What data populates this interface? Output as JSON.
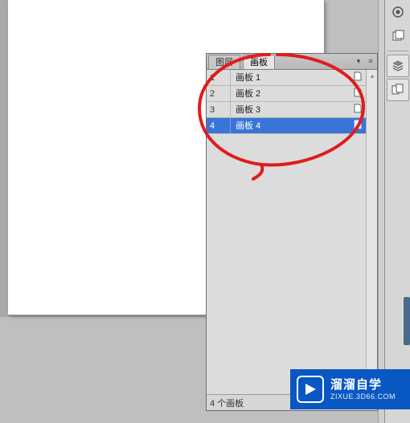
{
  "panel": {
    "tabs": [
      {
        "label": "图层",
        "active": false
      },
      {
        "label": "画板",
        "active": true
      }
    ],
    "artboards": [
      {
        "num": "1",
        "name": "画板 1",
        "selected": false
      },
      {
        "num": "2",
        "name": "画板 2",
        "selected": false
      },
      {
        "num": "3",
        "name": "画板 3",
        "selected": false
      },
      {
        "num": "4",
        "name": "画板 4",
        "selected": true
      }
    ],
    "footer_count": "4 个画板"
  },
  "toolbar": {
    "icons": [
      "circle-target-icon",
      "artboard-tool-icon",
      "layers-icon",
      "artboards-icon"
    ]
  },
  "watermark": {
    "cn": "溜溜自学",
    "en": "ZIXUE.3D66.COM"
  },
  "colors": {
    "selection": "#3875d7",
    "panel_bg": "#d6d6d6",
    "watermark_bg": "#0957c3",
    "annotation": "#e11"
  }
}
